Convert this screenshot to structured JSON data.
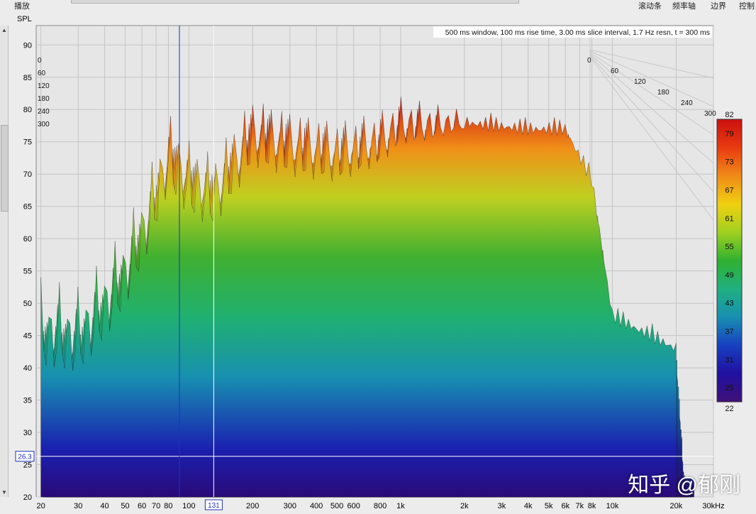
{
  "menus": [
    "播放",
    "滚动条",
    "频率轴",
    "边界",
    "控制"
  ],
  "chart_data": {
    "type": "waterfall",
    "ylabel": "SPL",
    "xlabel_unit": "30kHz",
    "info": "500 ms window, 100 ms rise time, 3.00 ms slice interval, 1.7 Hz resn, t = 300 ms",
    "ylim": [
      20,
      93
    ],
    "yticks": [
      20,
      25,
      30,
      35,
      40,
      45,
      50,
      55,
      60,
      65,
      70,
      75,
      80,
      85,
      90
    ],
    "x_scale": "log",
    "xlim": [
      19,
      30000
    ],
    "xticks": [
      "20",
      "30",
      "40",
      "50",
      "60",
      "70",
      "80",
      "100",
      "131",
      "200",
      "300",
      "400",
      "500",
      "600",
      "800",
      "1k",
      "2k",
      "3k",
      "4k",
      "5k",
      "6k",
      "7k",
      "8k",
      "10k",
      "20k",
      "30kHz"
    ],
    "xtick_values": [
      20,
      30,
      40,
      50,
      60,
      70,
      80,
      100,
      131,
      200,
      300,
      400,
      500,
      600,
      800,
      1000,
      2000,
      3000,
      4000,
      5000,
      6000,
      7000,
      8000,
      10000,
      20000,
      30000
    ],
    "time_ticks_ms": [
      "0",
      "60",
      "120",
      "180",
      "240",
      "300"
    ],
    "cursor_level": "26.3",
    "cursor_freq": "131",
    "colorbar": {
      "max": "82",
      "min": "22",
      "ticks": [
        "79",
        "73",
        "67",
        "61",
        "55",
        "49",
        "43",
        "37",
        "31",
        "25"
      ],
      "colors": [
        "#cc1010",
        "#e83a10",
        "#f08a18",
        "#f0d010",
        "#a0d020",
        "#30b030",
        "#20b080",
        "#1890b0",
        "#1840c0",
        "#2010a0",
        "#40107a"
      ]
    },
    "front_slice_peaks": [
      {
        "f": 20,
        "spl": 54
      },
      {
        "f": 30,
        "spl": 53
      },
      {
        "f": 40,
        "spl": 58
      },
      {
        "f": 50,
        "spl": 63
      },
      {
        "f": 60,
        "spl": 69
      },
      {
        "f": 70,
        "spl": 75
      },
      {
        "f": 80,
        "spl": 81
      },
      {
        "f": 100,
        "spl": 77
      },
      {
        "f": 131,
        "spl": 75
      },
      {
        "f": 200,
        "spl": 84
      },
      {
        "f": 300,
        "spl": 82
      },
      {
        "f": 500,
        "spl": 80
      },
      {
        "f": 800,
        "spl": 81
      },
      {
        "f": 1000,
        "spl": 83
      },
      {
        "f": 2000,
        "spl": 80
      },
      {
        "f": 4000,
        "spl": 79
      },
      {
        "f": 6000,
        "spl": 79
      },
      {
        "f": 8000,
        "spl": 71
      },
      {
        "f": 10000,
        "spl": 50
      },
      {
        "f": 20000,
        "spl": 45
      }
    ]
  },
  "watermark": "知乎 @郁刚"
}
